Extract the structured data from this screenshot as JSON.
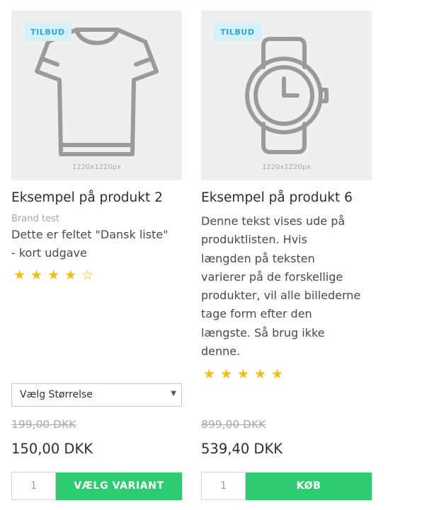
{
  "products": [
    {
      "badge": "TILBUD",
      "image_dims": "1220x1220px",
      "image_icon": "tshirt-icon",
      "title": "Eksempel på produkt 2",
      "brand": "Brand test",
      "description_lines": [
        "Dette er feltet \"Dansk liste\"",
        "- kort udgave"
      ],
      "rating": 4,
      "rating_max": 5,
      "select_label": "Vælg Størrelse",
      "old_price": "199,00 DKK",
      "price": "150,00 DKK",
      "quantity": "1",
      "button_label": "VÆLG VARIANT"
    },
    {
      "badge": "TILBUD",
      "image_dims": "1220x1220px",
      "image_icon": "watch-icon",
      "title": "Eksempel på produkt 6",
      "description_lines": [
        "Denne tekst vises ude på",
        "produktlisten. Hvis",
        "længden på teksten",
        "varierer på de forskellige",
        "produkter, vil alle billederne",
        "tage form efter den",
        "længste. Så brug ikke",
        "denne."
      ],
      "rating": 5,
      "rating_max": 5,
      "old_price": "899,00 DKK",
      "price": "539,40 DKK",
      "quantity": "1",
      "button_label": "KØB"
    }
  ],
  "colors": {
    "accent_button": "#2ecc71",
    "badge_bg": "#d6f0fa",
    "badge_text": "#27a9d8",
    "star": "#f2bf0f"
  }
}
